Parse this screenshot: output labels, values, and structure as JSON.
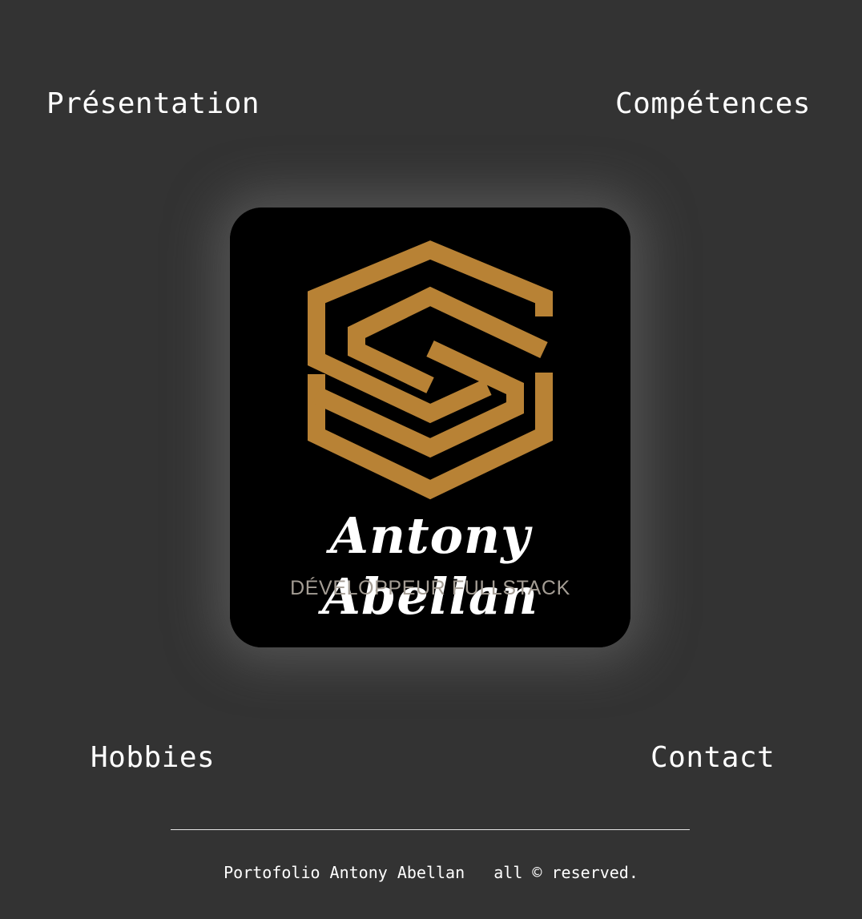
{
  "nav": {
    "top_left": "Présentation",
    "top_right": "Compétences",
    "bottom_left": "Hobbies",
    "bottom_right": "Contact"
  },
  "logo": {
    "name": "Antony Abellan",
    "subtitle": "DÉVELOPPEUR FULLSTACK",
    "mark_icon": "hexagon-s-monogram-icon",
    "mark_color": "#b88235",
    "background_color": "#000000"
  },
  "footer": {
    "text": "Portofolio Antony Abellan   all © reserved."
  },
  "colors": {
    "page_background": "#333333",
    "text": "#ffffff",
    "accent": "#b88235",
    "subtitle": "#a49d94"
  }
}
